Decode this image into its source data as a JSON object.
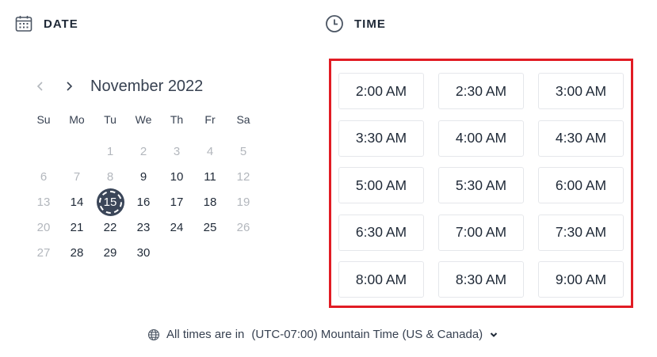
{
  "date_section": {
    "title": "DATE",
    "icon": "calendar-icon"
  },
  "time_section": {
    "title": "TIME",
    "icon": "clock-icon"
  },
  "calendar": {
    "month_label": "November 2022",
    "prev_icon": "chevron-left-icon",
    "next_icon": "chevron-right-icon",
    "weekdays": [
      "Su",
      "Mo",
      "Tu",
      "We",
      "Th",
      "Fr",
      "Sa"
    ],
    "days": [
      {
        "label": "",
        "state": "empty"
      },
      {
        "label": "",
        "state": "empty"
      },
      {
        "label": "1",
        "state": "disabled"
      },
      {
        "label": "2",
        "state": "disabled"
      },
      {
        "label": "3",
        "state": "disabled"
      },
      {
        "label": "4",
        "state": "disabled"
      },
      {
        "label": "5",
        "state": "disabled"
      },
      {
        "label": "6",
        "state": "disabled"
      },
      {
        "label": "7",
        "state": "disabled"
      },
      {
        "label": "8",
        "state": "disabled"
      },
      {
        "label": "9",
        "state": "available"
      },
      {
        "label": "10",
        "state": "available"
      },
      {
        "label": "11",
        "state": "available"
      },
      {
        "label": "12",
        "state": "disabled"
      },
      {
        "label": "13",
        "state": "disabled"
      },
      {
        "label": "14",
        "state": "available"
      },
      {
        "label": "15",
        "state": "selected"
      },
      {
        "label": "16",
        "state": "available"
      },
      {
        "label": "17",
        "state": "available"
      },
      {
        "label": "18",
        "state": "available"
      },
      {
        "label": "19",
        "state": "disabled"
      },
      {
        "label": "20",
        "state": "disabled"
      },
      {
        "label": "21",
        "state": "available"
      },
      {
        "label": "22",
        "state": "available"
      },
      {
        "label": "23",
        "state": "available"
      },
      {
        "label": "24",
        "state": "available"
      },
      {
        "label": "25",
        "state": "available"
      },
      {
        "label": "26",
        "state": "disabled"
      },
      {
        "label": "27",
        "state": "disabled"
      },
      {
        "label": "28",
        "state": "available"
      },
      {
        "label": "29",
        "state": "available"
      },
      {
        "label": "30",
        "state": "available"
      }
    ]
  },
  "time_slots": [
    "2:00 AM",
    "2:30 AM",
    "3:00 AM",
    "3:30 AM",
    "4:00 AM",
    "4:30 AM",
    "5:00 AM",
    "5:30 AM",
    "6:00 AM",
    "6:30 AM",
    "7:00 AM",
    "7:30 AM",
    "8:00 AM",
    "8:30 AM",
    "9:00 AM"
  ],
  "timezone": {
    "prefix": "All times are in",
    "value": "(UTC-07:00) Mountain Time (US & Canada)",
    "icon": "globe-icon",
    "dropdown_icon": "chevron-down-icon"
  },
  "colors": {
    "selected_day": "#3b4659",
    "highlight_border": "#e11c24",
    "disabled_text": "#b3b7bd"
  }
}
